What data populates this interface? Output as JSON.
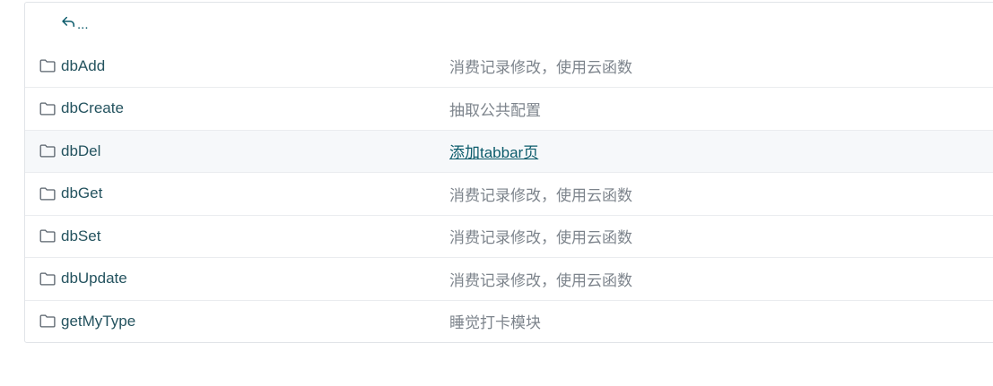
{
  "up_row": {
    "label": "..."
  },
  "rows": [
    {
      "name": "dbAdd",
      "message": "消费记录修改，使用云函数",
      "hovered": false
    },
    {
      "name": "dbCreate",
      "message": "抽取公共配置",
      "hovered": false
    },
    {
      "name": "dbDel",
      "message": "添加tabbar页",
      "hovered": true
    },
    {
      "name": "dbGet",
      "message": "消费记录修改，使用云函数",
      "hovered": false
    },
    {
      "name": "dbSet",
      "message": "消费记录修改，使用云函数",
      "hovered": false
    },
    {
      "name": "dbUpdate",
      "message": "消费记录修改，使用云函数",
      "hovered": false
    },
    {
      "name": "getMyType",
      "message": "睡觉打卡模块",
      "hovered": false
    }
  ],
  "colors": {
    "link": "#0b5b6b",
    "name": "#24535f",
    "muted": "#7d848c",
    "hover_bg": "#f6f8fa",
    "border": "#e1e4e8"
  }
}
